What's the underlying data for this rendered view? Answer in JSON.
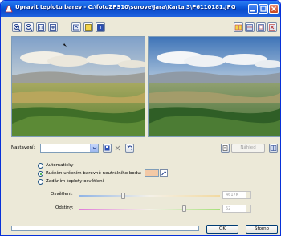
{
  "window": {
    "title": "Upravit teplotu barev - C:\\fotoZPS10\\surove\\Jara\\Karta 3\\P6110181.JPG"
  },
  "toolbar": {
    "left_icons": [
      "zoom-in-icon",
      "zoom-out-icon",
      "actual-size-icon",
      "fit-window-icon",
      "move-image-icon",
      "show-before-icon",
      "info-icon"
    ],
    "right_icons": [
      "view-side-by-side-icon",
      "view-split-icon",
      "view-single-icon",
      "close-preview-icon"
    ]
  },
  "settings": {
    "label": "Nastavení:",
    "preset_value": "",
    "preview_label": "Náhled"
  },
  "modes": {
    "automatic": "Automaticky",
    "manual_neutral": "Ručním určením barevně neutrálního bodu:",
    "color_temperature": "Zadáním teploty osvětlení",
    "selected": "manual_neutral"
  },
  "sliders": {
    "lighting_label": "Osvětlení:",
    "lighting_value": "4617K",
    "tint_label": "Odstíny:",
    "tint_value": "52"
  },
  "buttons": {
    "ok": "OK",
    "cancel": "Storno"
  },
  "colors": {
    "titlebar": "#0b56d8",
    "neutral_swatch": "#f3c9a6",
    "dialog_bg": "#ece9d8"
  }
}
